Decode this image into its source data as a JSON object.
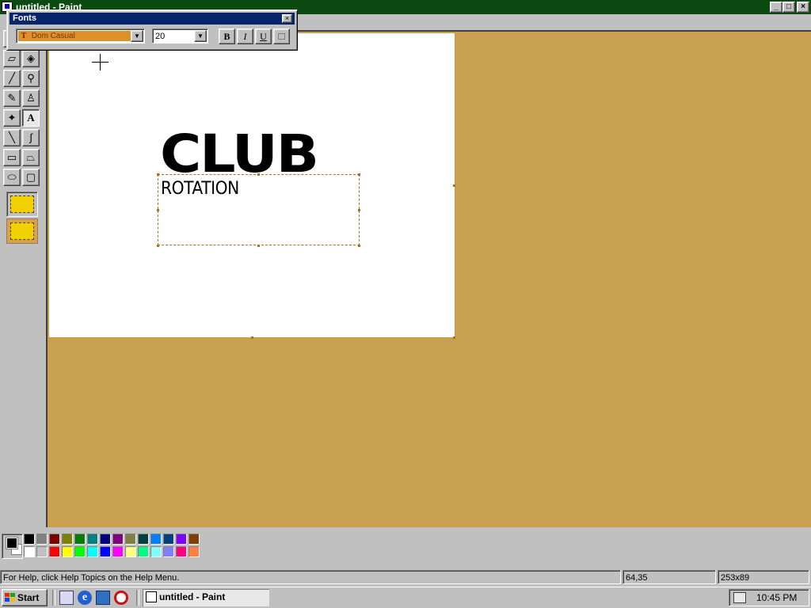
{
  "window": {
    "title": "untitled - Paint",
    "minimize": "_",
    "maximize": "□",
    "close": "×"
  },
  "canvas": {
    "heading_text": "CLUB",
    "textbox_text": "ROTATION"
  },
  "fonts_toolbar": {
    "title": "Fonts",
    "close": "×",
    "font_name": "Dom Casual",
    "font_icon": "T",
    "font_size": "20",
    "bold_label": "B",
    "italic_label": "I",
    "underline_label": "U"
  },
  "tools": [
    {
      "name": "free-form-select-icon",
      "glyph": "✂"
    },
    {
      "name": "select-icon",
      "glyph": "⬚"
    },
    {
      "name": "eraser-icon",
      "glyph": "▱"
    },
    {
      "name": "fill-bucket-icon",
      "glyph": "◈"
    },
    {
      "name": "color-picker-icon",
      "glyph": "╱"
    },
    {
      "name": "magnifier-icon",
      "glyph": "⚲"
    },
    {
      "name": "pencil-icon",
      "glyph": "✎"
    },
    {
      "name": "brush-icon",
      "glyph": "♙"
    },
    {
      "name": "airbrush-icon",
      "glyph": "✦"
    },
    {
      "name": "text-tool-icon",
      "glyph": "A"
    },
    {
      "name": "line-icon",
      "glyph": "╲"
    },
    {
      "name": "curve-icon",
      "glyph": "∫"
    },
    {
      "name": "rectangle-icon",
      "glyph": "▭"
    },
    {
      "name": "polygon-icon",
      "glyph": "⏢"
    },
    {
      "name": "ellipse-icon",
      "glyph": "⬭"
    },
    {
      "name": "rounded-rectangle-icon",
      "glyph": "▢"
    }
  ],
  "palette": {
    "foreground": "#000000",
    "background": "#ffffff",
    "top_row": [
      "#000000",
      "#808080",
      "#800000",
      "#808000",
      "#008000",
      "#008080",
      "#000080",
      "#800080",
      "#808040",
      "#004040",
      "#0080ff",
      "#004080",
      "#8000ff",
      "#804000"
    ],
    "bottom_row": [
      "#ffffff",
      "#c0c0c0",
      "#ff0000",
      "#ffff00",
      "#00ff00",
      "#00ffff",
      "#0000ff",
      "#ff00ff",
      "#ffff80",
      "#00ff80",
      "#80ffff",
      "#8080ff",
      "#ff0080",
      "#ff8040"
    ]
  },
  "statusbar": {
    "help_text": "For Help, click Help Topics on the Help Menu.",
    "coordinates": "64,35",
    "selection_size": "253x89"
  },
  "taskbar": {
    "start_label": "Start",
    "task_label": "untitled - Paint",
    "clock": "10:45 PM"
  },
  "colors": {
    "workspace": "#c8a050",
    "titlebar": "#0b4a10",
    "fonts_titlebar": "#08246b"
  }
}
